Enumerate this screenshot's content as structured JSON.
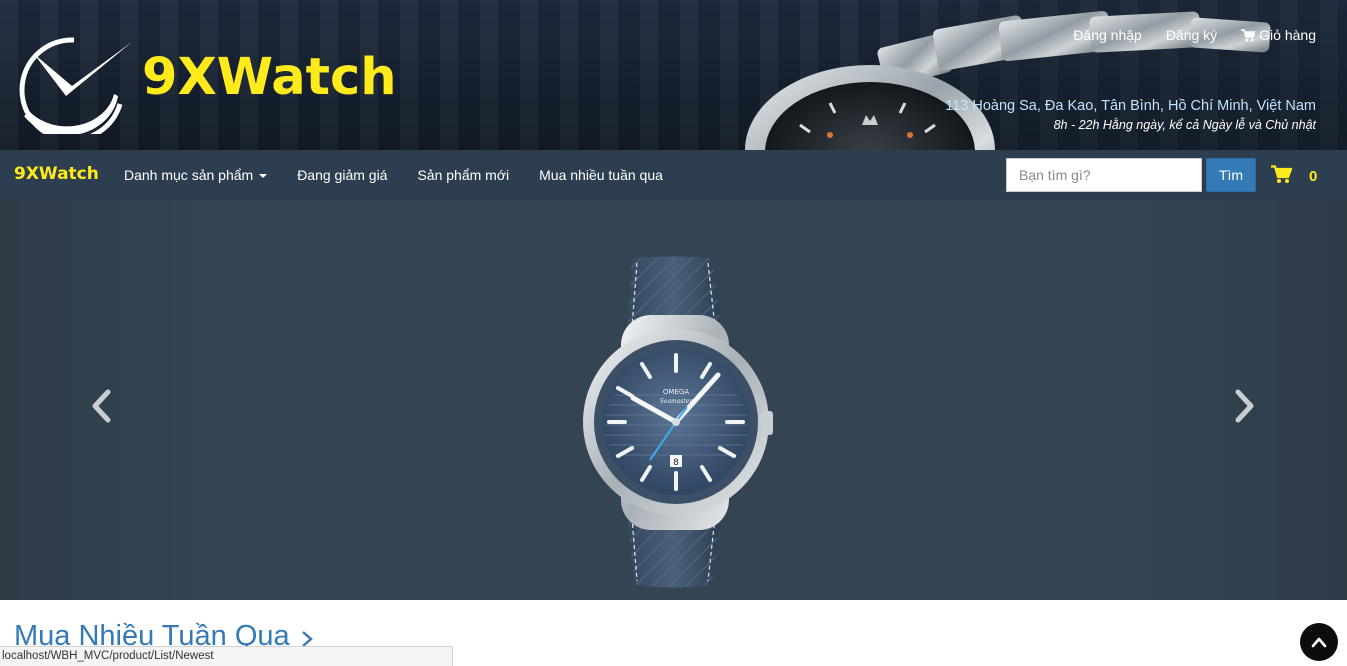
{
  "header": {
    "logo_text": "9XWatch",
    "links": {
      "login": "Đăng nhập",
      "register": "Đăng ký",
      "cart": "Giỏ hàng"
    },
    "address": "113 Hoàng Sa, Đa Kao, Tân Bình, Hồ Chí Minh, Việt Nam",
    "hours": "8h - 22h Hằng ngày, kể cả Ngày lễ và Chủ nhật"
  },
  "navbar": {
    "brand": "9XWatch",
    "items": [
      {
        "label": "Danh mục sản phẩm",
        "dropdown": true
      },
      {
        "label": "Đang giảm giá"
      },
      {
        "label": "Sản phẩm mới"
      },
      {
        "label": "Mua nhiều tuần qua"
      }
    ],
    "search": {
      "placeholder": "Bạn tìm gì?",
      "button": "Tìm"
    },
    "cart_count": "0"
  },
  "carousel": {
    "watch_brand": "OMEGA",
    "watch_model": "Seamaster",
    "date": "8"
  },
  "section": {
    "title": "Mua Nhiều Tuần Qua"
  },
  "status_bar": {
    "url": "localhost/WBH_MVC/product/List/Newest"
  },
  "colors": {
    "logo_yellow": "#ffeb1c",
    "navbar_bg": "#2d3e50",
    "carousel_bg": "#344452",
    "link_blue": "#337ab7"
  },
  "icons": [
    "logo-check-icon",
    "cart-icon",
    "chevron-left-icon",
    "chevron-right-icon",
    "chevron-up-icon"
  ]
}
